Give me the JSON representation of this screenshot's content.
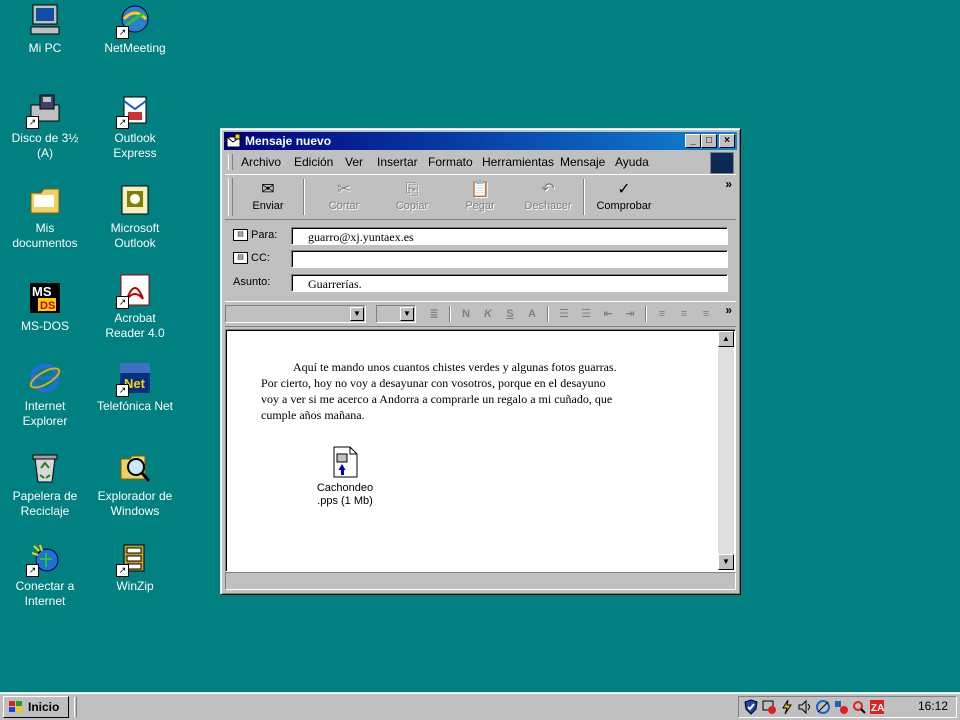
{
  "desktop": {
    "icons": [
      {
        "label": "Mi PC"
      },
      {
        "label": "NetMeeting"
      },
      {
        "label": "Disco de 3½\n(A)"
      },
      {
        "label": "Outlook\nExpress"
      },
      {
        "label": "Mis\ndocumentos"
      },
      {
        "label": "Microsoft\nOutlook"
      },
      {
        "label": "MS-DOS"
      },
      {
        "label": "Acrobat\nReader 4.0"
      },
      {
        "label": "Internet\nExplorer"
      },
      {
        "label": "Telefónica Net"
      },
      {
        "label": "Papelera de\nReciclaje"
      },
      {
        "label": "Explorador de\nWindows"
      },
      {
        "label": "Conectar a\nInternet"
      },
      {
        "label": "WinZip"
      }
    ]
  },
  "window": {
    "title": "Mensaje nuevo",
    "menu": [
      "Archivo",
      "Edición",
      "Ver",
      "Insertar",
      "Formato",
      "Herramientas",
      "Mensaje",
      "Ayuda"
    ],
    "toolbar": {
      "send": "Enviar",
      "cut": "Cortar",
      "copy": "Copiar",
      "paste": "Pegar",
      "undo": "Deshacer",
      "check": "Comprobar",
      "more": "»"
    },
    "headers": {
      "to_label": "Para:",
      "to_value": "guarro@xj.yuntaex.es",
      "cc_label": "CC:",
      "cc_value": "",
      "subject_label": "Asunto:",
      "subject_value": "Guarrerías."
    },
    "body": {
      "text": "Aquí te mando unos cuantos chistes verdes y algunas fotos guarras. Por cierto, hoy no voy a desayunar con vosotros, porque en el desayuno voy a ver si me acerco a Andorra a comprarle un regalo a mi cuñado, que cumple años mañana.",
      "attachment": "Cachondeo\n.pps (1 Mb)"
    }
  },
  "taskbar": {
    "start": "Inicio",
    "clock": "16:12"
  },
  "colors": {
    "desktop": "#008080",
    "titlebar": "#000080",
    "face": "#c0c0c0"
  }
}
